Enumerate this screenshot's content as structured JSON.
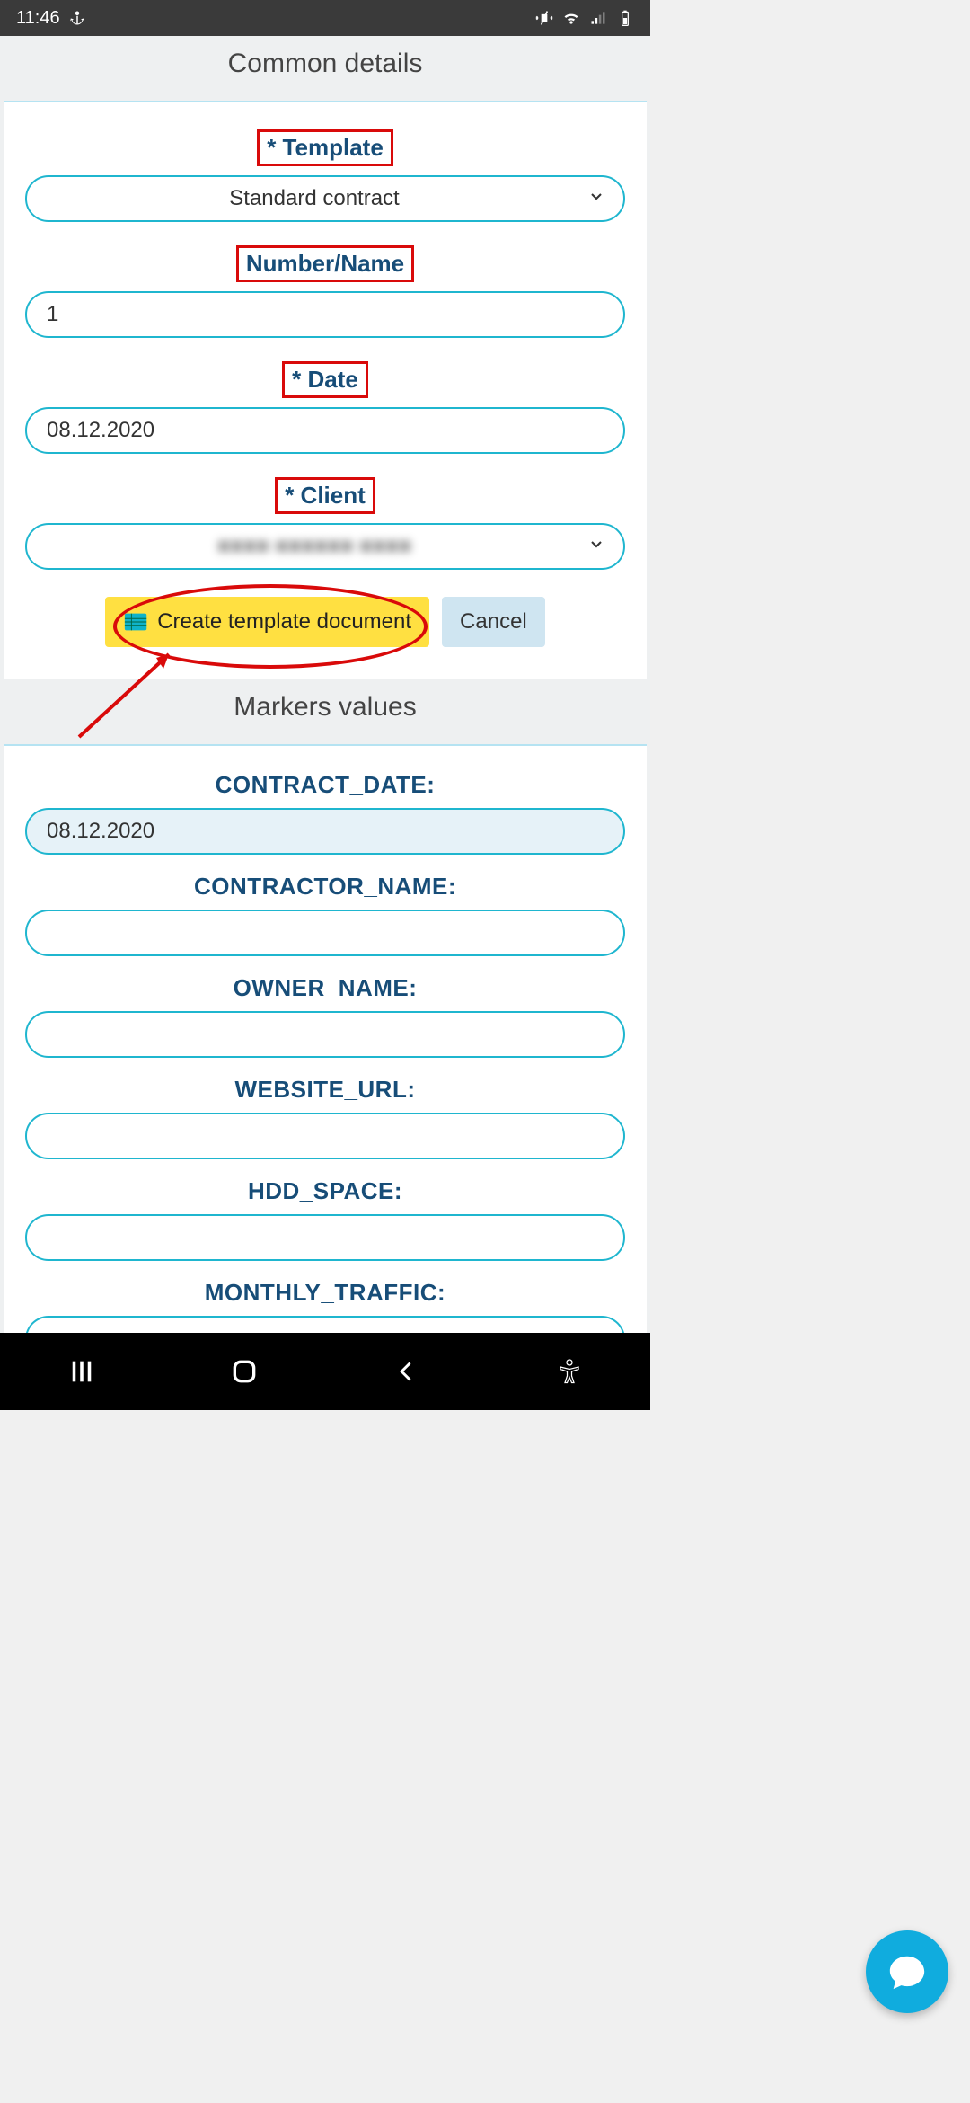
{
  "status": {
    "time": "11:46"
  },
  "sections": {
    "common_header": "Common details",
    "markers_header": "Markers values"
  },
  "common": {
    "template_label": "* Template",
    "template_value": "Standard contract",
    "number_label": "Number/Name",
    "number_value": "1",
    "date_label": "* Date",
    "date_value": "08.12.2020",
    "client_label": "* Client",
    "client_value": "■■■■ ■■■■■■ ■■■■"
  },
  "buttons": {
    "create_label": "Create template document",
    "cancel_label": "Cancel"
  },
  "markers": {
    "contract_date_label": "CONTRACT_DATE:",
    "contract_date_value": "08.12.2020",
    "contractor_name_label": "CONTRACTOR_NAME:",
    "contractor_name_value": "",
    "owner_name_label": "OWNER_NAME:",
    "owner_name_value": "",
    "website_url_label": "WEBSITE_URL:",
    "website_url_value": "",
    "hdd_space_label": "HDD_SPACE:",
    "hdd_space_value": "",
    "monthly_traffic_label": "MONTHLY_TRAFFIC:",
    "monthly_traffic_value": ""
  },
  "annotations": {
    "highlighted_labels_red_box": [
      "template",
      "number",
      "date",
      "client"
    ],
    "primary_button_red_ellipse_with_arrow": true
  },
  "colors": {
    "accent_border": "#1fb6cf",
    "label_text": "#174d78",
    "primary_button": "#ffe041",
    "secondary_button": "#cfe5f1",
    "fab": "#10acde",
    "annotation_red": "#d90a0a"
  }
}
